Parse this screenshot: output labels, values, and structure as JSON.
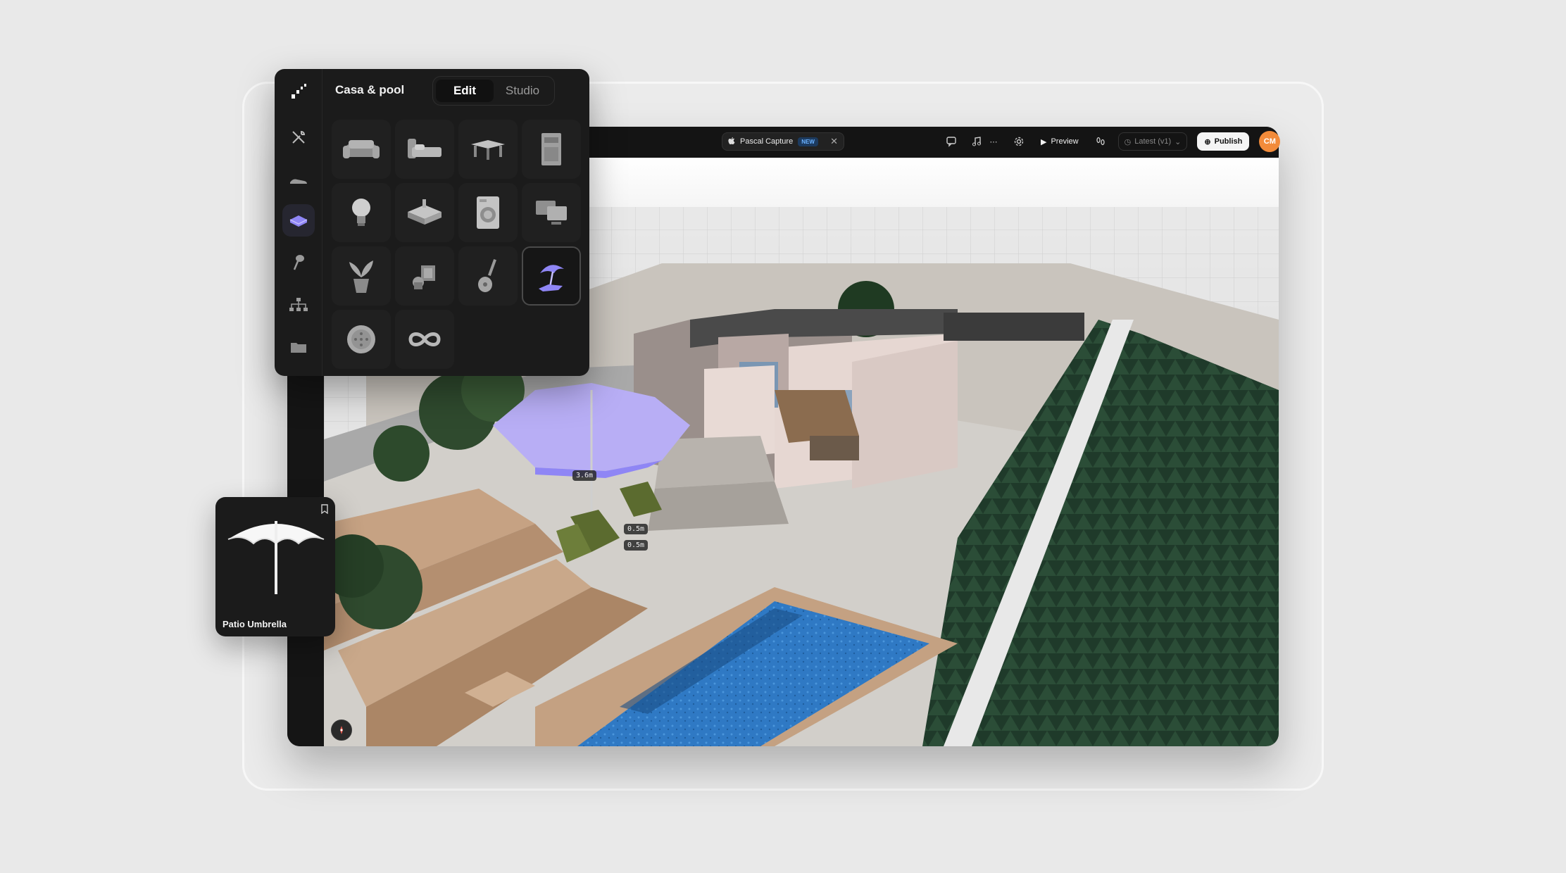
{
  "panel": {
    "title": "Casa & pool",
    "modes": [
      "Edit",
      "Studio"
    ],
    "active_mode": "Edit",
    "rail_items": [
      "tools-icon",
      "shoe-icon",
      "sofa-icon",
      "brush-icon",
      "hierarchy-icon",
      "folder-icon"
    ],
    "active_rail_item": "sofa-icon",
    "catalog_items": [
      "sofa-icon",
      "bed-icon",
      "table-icon",
      "cabinet-icon",
      "lightbulb-icon",
      "sink-icon",
      "washing-machine-icon",
      "electronics-icon",
      "plant-icon",
      "decor-icon",
      "guitar-icon",
      "patio-umbrella-icon",
      "speaker-icon",
      "infinity-icon"
    ],
    "selected_item": "patio-umbrella-icon"
  },
  "topbar": {
    "capture_label": "Pascal Capture",
    "capture_badge": "NEW",
    "preview_label": "Preview",
    "version_label": "Latest (v1)",
    "publish_label": "Publish",
    "avatar_initials": "CM",
    "icons": [
      "comment-icon",
      "music-icon",
      "more-icon",
      "settings-icon",
      "play-icon",
      "footsteps-icon",
      "clock-icon",
      "chevron-down-icon",
      "publish-icon"
    ]
  },
  "preview_card": {
    "name": "Patio Umbrella"
  },
  "dimensions": {
    "umbrella_height": "3.6m",
    "chair_width": "0.5m",
    "chair_depth": "0.5m"
  },
  "colors": {
    "accent": "#8f86f5",
    "avatar": "#f28b3a",
    "new_badge": "#6bb2ff"
  }
}
